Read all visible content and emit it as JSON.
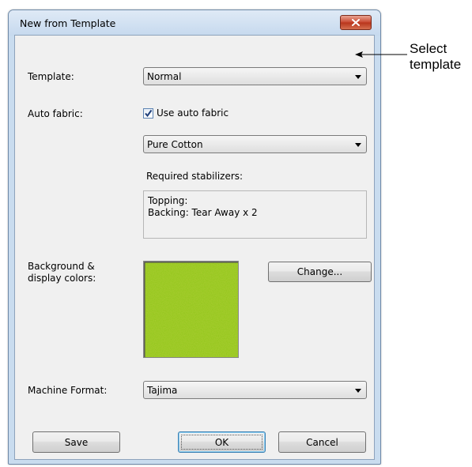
{
  "window": {
    "title": "New from Template"
  },
  "labels": {
    "template": "Template:",
    "auto_fabric": "Auto fabric:",
    "background_line1": "Background &",
    "background_line2": "display colors:",
    "machine_format": "Machine Format:"
  },
  "template_select": {
    "value": "Normal"
  },
  "auto_fabric": {
    "checkbox_label": "Use auto fabric",
    "checked": true
  },
  "fabric_select": {
    "value": "Pure Cotton"
  },
  "stabilizers": {
    "heading": "Required stabilizers:",
    "lines": [
      "Topping:",
      "Backing: Tear Away x 2"
    ]
  },
  "background": {
    "color": "#96c81e",
    "change_button": "Change..."
  },
  "machine_format_select": {
    "value": "Tajima"
  },
  "buttons": {
    "save": "Save",
    "ok": "OK",
    "cancel": "Cancel"
  },
  "annotation": {
    "line1": "Select",
    "line2": "template"
  },
  "icons": {
    "close": "close-icon",
    "check": "check-icon",
    "dropdown": "chevron-down-icon"
  }
}
